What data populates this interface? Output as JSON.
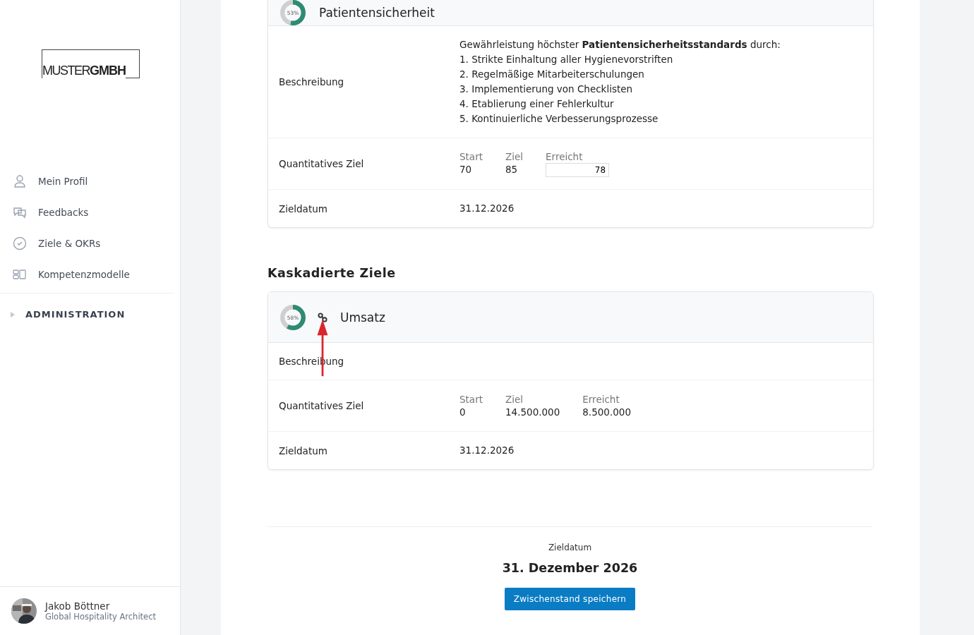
{
  "sidebar": {
    "logo": {
      "light": "MUSTER",
      "bold": "GMBH"
    },
    "items": [
      {
        "label": "Mein Profil"
      },
      {
        "label": "Feedbacks"
      },
      {
        "label": "Ziele & OKRs"
      },
      {
        "label": "Kompetenzmodelle"
      }
    ],
    "section": {
      "label": "ADMINISTRATION",
      "expanded": false
    },
    "user": {
      "name": "Jakob Böttner",
      "role": "Global Hospitality Architect"
    }
  },
  "goal": {
    "title": "Patientensicherheit",
    "gauge": {
      "level": 0.53,
      "label": "53%"
    },
    "linked": false,
    "rows": [
      {
        "kind": "text",
        "label": "Beschreibung",
        "intro": "Gewährleistung höchster **Patientensicherheitsstandards** durch:",
        "list": [
          "1. Strikte Einhaltung aller Hygienevorstriften",
          "2. Regelmäßige Mitarbeiterschulungen",
          "3. Implementierung von Checklisten",
          "4. Etablierung einer Fehlerkultur",
          "5. Kontinuierliche Verbesserungsprozesse"
        ]
      },
      {
        "kind": "quant",
        "label": "Quantitatives Ziel",
        "columns": [
          {
            "heading": "Start",
            "value": "70",
            "editable": false
          },
          {
            "heading": "Ziel",
            "value": "85",
            "editable": false
          },
          {
            "heading": "Erreicht",
            "value": "78",
            "editable": true
          }
        ]
      },
      {
        "kind": "text",
        "label": "Zieldatum",
        "intro": "31.12.2026"
      }
    ]
  },
  "cascade_heading": "Kaskadierte Ziele",
  "cascaded": [
    {
      "title": "Umsatz",
      "gauge": {
        "level": 0.58,
        "label": "58%"
      },
      "linked": true,
      "rows": [
        {
          "kind": "text",
          "label": "Beschreibung"
        },
        {
          "kind": "quant",
          "label": "Quantitatives Ziel",
          "columns": [
            {
              "heading": "Start",
              "value": "0",
              "editable": false
            },
            {
              "heading": "Ziel",
              "value": "14.500.000",
              "editable": false
            },
            {
              "heading": "Erreicht",
              "value": "8.500.000",
              "editable": false
            }
          ]
        },
        {
          "kind": "text",
          "label": "Zieldatum",
          "intro": "31.12.2026"
        }
      ]
    }
  ],
  "footer": {
    "label": "Zieldatum",
    "date": "31. Dezember 2026",
    "button": "Zwischenstand speichern"
  }
}
